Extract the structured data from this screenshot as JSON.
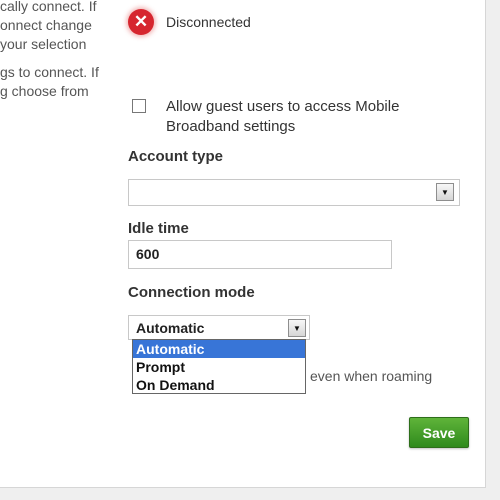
{
  "left_description": {
    "lines": [
      "cally connect. If",
      "onnect change",
      "your selection",
      "gs to connect. If",
      "g choose from"
    ]
  },
  "status": {
    "icon": "error-icon",
    "icon_glyph": "✕",
    "label": "Disconnected",
    "color": "#d6262f"
  },
  "guest_access": {
    "checked": false,
    "label": "Allow guest users to access Mobile Broadband settings"
  },
  "account_type": {
    "label": "Account type",
    "value": ""
  },
  "idle_time": {
    "label": "Idle time",
    "value": "600"
  },
  "connection_mode": {
    "label": "Connection mode",
    "value": "Automatic",
    "options": [
      "Automatic",
      "Prompt",
      "On Demand"
    ],
    "selected_index": 0
  },
  "roaming": {
    "text_visible": "even when roaming"
  },
  "actions": {
    "save_label": "Save",
    "save_color": "#2f8a1c"
  },
  "selection_color": "#3875d7"
}
